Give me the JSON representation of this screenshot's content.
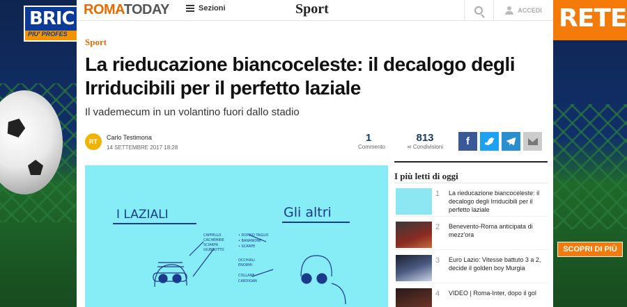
{
  "ads": {
    "left_brand": "BRIC",
    "left_tagline": "PIU' PROFES",
    "right_brand": "RETE",
    "right_cta": "SCOPRI DI PIÙ"
  },
  "header": {
    "logo_left": "ROMA",
    "logo_right": "TODAY",
    "menu_label": "Sezioni",
    "section_title": "Sport",
    "login_label": "ACCEDI"
  },
  "article": {
    "kicker": "Sport",
    "title": "La rieducazione biancoceleste: il decalogo degli Irriducibili per il perfetto laziale",
    "subtitle": "Il vademecum in un volantino fuori dallo stadio",
    "author_initials": "RT",
    "author": "Carlo Testimona",
    "date": "14 settembre 2017 18:28",
    "comments_count": "1",
    "comments_label": "Commento",
    "shares_count": "813",
    "shares_label": "Condivisioni",
    "image_text": {
      "left_heading": "I LAZIALI",
      "right_heading": "Gli altri"
    }
  },
  "sidebar": {
    "title": "I più letti di oggi",
    "items": [
      {
        "rank": "1",
        "text": "La rieducazione biancoceleste: il decalogo degli Irriducibili per il perfetto laziale"
      },
      {
        "rank": "2",
        "text": "Benevento-Roma anticipata di mezz'ora"
      },
      {
        "rank": "3",
        "text": "Euro Lazio: Vitesse battuto 3 a 2, decide il golden boy Murgia"
      },
      {
        "rank": "4",
        "text": "VIDEO | Roma-Inter, dopo il gol"
      }
    ]
  },
  "colors": {
    "brand_orange": "#e66b00",
    "facebook": "#3b5998",
    "twitter": "#1da1f2",
    "telegram": "#2a8fd0"
  }
}
